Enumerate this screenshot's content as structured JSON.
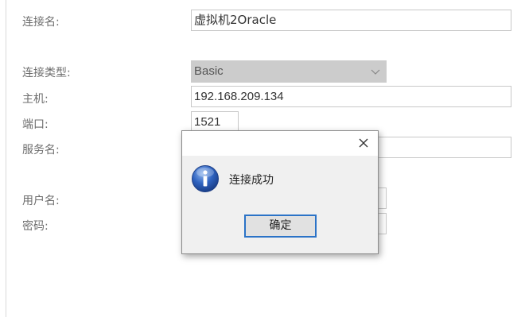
{
  "form": {
    "connection_name_label": "连接名:",
    "connection_name_value": "虚拟机2Oracle",
    "connection_type_label": "连接类型:",
    "connection_type_value": "Basic",
    "host_label": "主机:",
    "host_value": "192.168.209.134",
    "port_label": "端口:",
    "port_value": "1521",
    "service_name_label": "服务名:",
    "service_name_value": "",
    "username_label": "用户名:",
    "password_label": "密码:"
  },
  "dialog": {
    "message": "连接成功",
    "ok_label": "确定",
    "icons": {
      "info": "info-icon",
      "close": "close-icon"
    }
  },
  "colors": {
    "ok_border": "#2b73c7",
    "info_icon": "#2a5db0"
  }
}
